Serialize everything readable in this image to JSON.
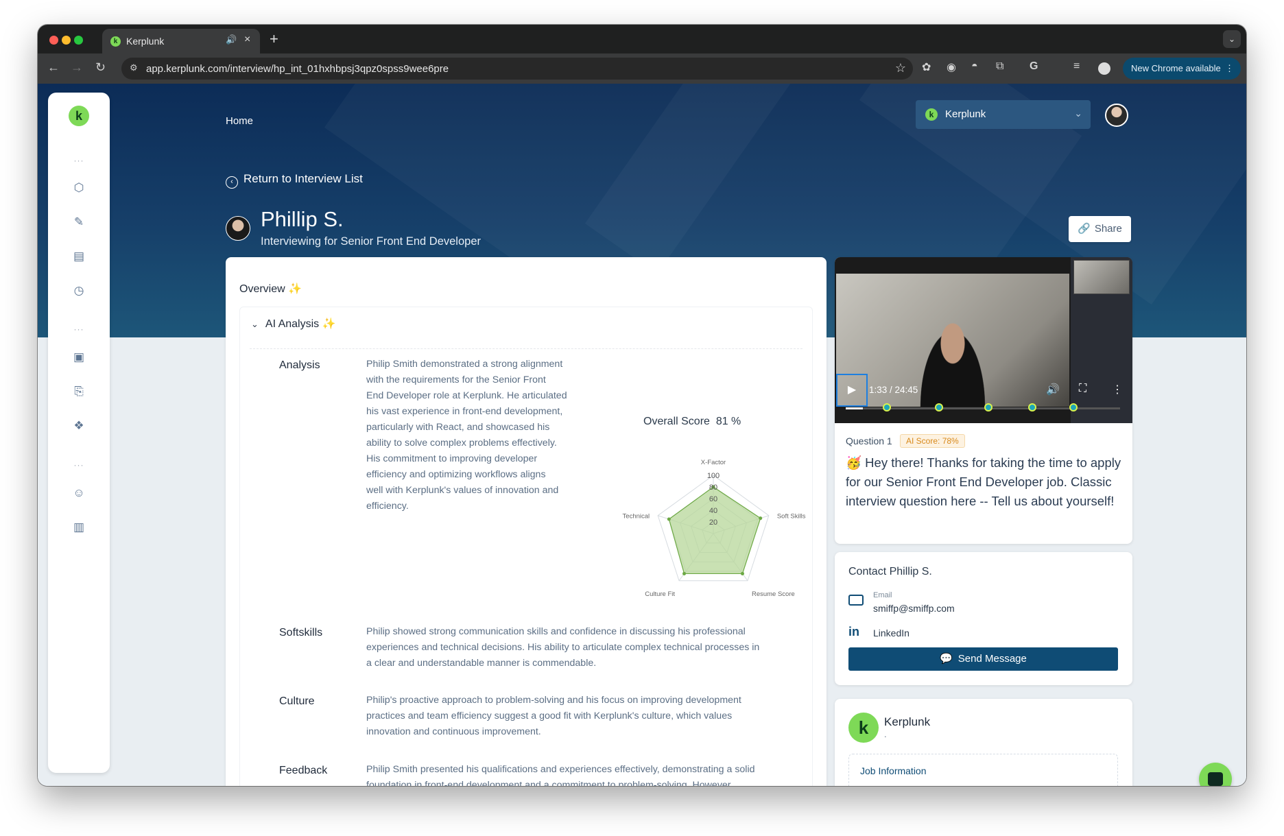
{
  "browser": {
    "tab_title": "Kerplunk",
    "tab_favicon": "k",
    "url": "app.kerplunk.com/interview/hp_int_01hxhbpsj3qpz0spss9wee6pre",
    "new_chrome": "New Chrome available",
    "traffic_colors": [
      "#ff5f57",
      "#febc2e",
      "#28c840"
    ]
  },
  "sidebar": {
    "logo": "k",
    "icons": [
      "cube-icon",
      "pencil-icon",
      "document-icon",
      "clock-icon",
      "book-icon",
      "bookmark-icon",
      "gift-icon",
      "users-icon",
      "briefcase-icon"
    ]
  },
  "header": {
    "home": "Home",
    "org_select": "Kerplunk",
    "org_logo": "k"
  },
  "back": "Return to Interview List",
  "candidate": {
    "name": "Phillip S.",
    "role": "Interviewing for Senior Front End Developer"
  },
  "share": "Share",
  "overview": {
    "title": "Overview ✨",
    "ai_title": "AI Analysis ✨",
    "sections": [
      {
        "label": "Analysis",
        "lines": [
          "Philip Smith demonstrated a strong alignment",
          "with the requirements for the Senior Front",
          "End Developer role at Kerplunk. He articulated",
          "his vast experience in front-end development,",
          "particularly with React, and showcased his",
          "ability to solve complex problems effectively.",
          "His commitment to improving developer",
          "efficiency and optimizing workflows aligns",
          "well with Kerplunk's values of innovation and",
          "efficiency."
        ]
      },
      {
        "label": "Softskills",
        "lines": [
          "Philip showed strong communication skills and confidence in discussing his professional",
          "experiences and technical decisions. His ability to articulate complex technical processes in",
          "a clear and understandable manner is commendable."
        ]
      },
      {
        "label": "Culture",
        "lines": [
          "Philip's proactive approach to problem-solving and his focus on improving development",
          "practices and team efficiency suggest a good fit with Kerplunk's culture, which values",
          "innovation and continuous improvement."
        ]
      },
      {
        "label": "Feedback",
        "lines": [
          "Philip Smith presented his qualifications and experiences effectively, demonstrating a solid",
          "foundation in front-end development and a commitment to problem-solving. However..."
        ]
      }
    ],
    "score_label": "Overall Score",
    "score_value": "81 %"
  },
  "chart_data": {
    "type": "radar",
    "axes": [
      "X-Factor",
      "Soft Skills",
      "Resume Score",
      "Culture Fit",
      "Technical"
    ],
    "values": [
      80,
      85,
      85,
      85,
      80
    ],
    "ticks": [
      "20",
      "40",
      "60",
      "80",
      "100"
    ],
    "range": [
      0,
      100
    ],
    "fill_color": "#b7d79a",
    "stroke_color": "#6ca844"
  },
  "video": {
    "time": "1:33 / 24:45",
    "progress": 0.063,
    "marker_positions": [
      0.15,
      0.34,
      0.52,
      0.68,
      0.83
    ]
  },
  "question": {
    "label": "Question 1",
    "badge": "AI Score: 78%",
    "text": "🥳 Hey there! Thanks for taking the time to apply for our Senior Front End Developer job. Classic interview question here -- Tell us about yourself!"
  },
  "contact": {
    "title": "Contact Phillip S.",
    "email_label": "Email",
    "email": "smiffp@smiffp.com",
    "linkedin": "LinkedIn",
    "linkedin_icon": "in",
    "send": "Send Message"
  },
  "org_card": {
    "logo": "k",
    "name": "Kerplunk",
    "sub": ".",
    "job_info": "Job Information"
  }
}
